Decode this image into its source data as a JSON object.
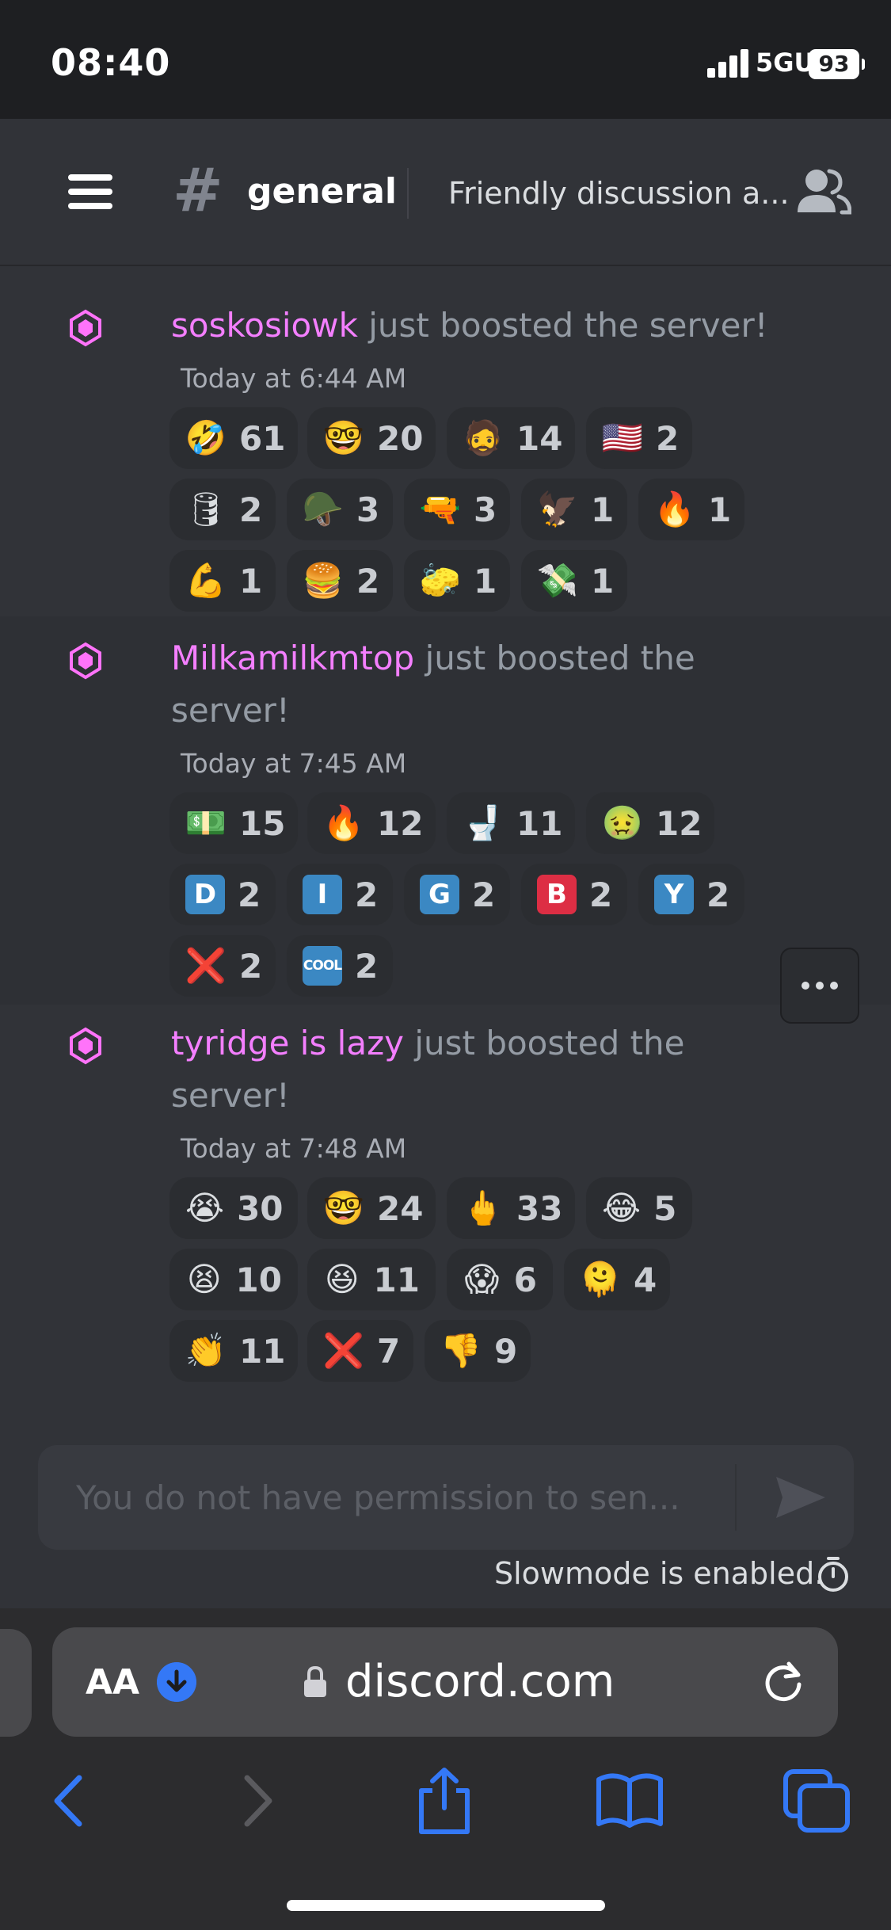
{
  "status_bar": {
    "time": "08:40",
    "network": "5GUC",
    "battery": "93"
  },
  "channel_header": {
    "channel_name": "general",
    "topic": "Friendly discussion a..."
  },
  "messages": [
    {
      "username": "soskosiowk",
      "text": " just boosted the server!",
      "timestamp": "Today at 6:44 AM",
      "reactions": [
        {
          "emoji": "🤣",
          "count": "61"
        },
        {
          "emoji": "🤓",
          "count": "20"
        },
        {
          "emoji": "🧔",
          "count": "14"
        },
        {
          "emoji": "🇺🇸",
          "count": "2"
        },
        {
          "emoji": "🛢",
          "count": "2"
        },
        {
          "emoji": "🪖",
          "count": "3"
        },
        {
          "emoji": "🔫",
          "count": "3"
        },
        {
          "emoji": "🦅",
          "count": "1"
        },
        {
          "emoji": "🔥",
          "count": "1"
        },
        {
          "emoji": "💪",
          "count": "1"
        },
        {
          "emoji": "🍔",
          "count": "2"
        },
        {
          "emoji": "🧽",
          "count": "1"
        },
        {
          "emoji": "💸",
          "count": "1"
        }
      ]
    },
    {
      "username": "Milkamilkmtop",
      "text": " just boosted the server!",
      "timestamp": "Today at 7:45 AM",
      "reactions": [
        {
          "emoji": "💵",
          "count": "15"
        },
        {
          "emoji": "🔥",
          "count": "12"
        },
        {
          "emoji": "🚽",
          "count": "11"
        },
        {
          "emoji": "🤢",
          "count": "12"
        },
        {
          "emoji": "D",
          "count": "2"
        },
        {
          "emoji": "I",
          "count": "2"
        },
        {
          "emoji": "G",
          "count": "2"
        },
        {
          "emoji": "B",
          "count": "2"
        },
        {
          "emoji": "Y",
          "count": "2"
        },
        {
          "emoji": "❌",
          "count": "2"
        },
        {
          "emoji": "COOL",
          "count": "2"
        }
      ]
    },
    {
      "username": "tyridge is lazy",
      "text": " just boosted the server!",
      "timestamp": "Today at 7:48 AM",
      "reactions": [
        {
          "emoji": "😭",
          "count": "30"
        },
        {
          "emoji": "🤓",
          "count": "24"
        },
        {
          "emoji": "🖕",
          "count": "33"
        },
        {
          "emoji": "😂",
          "count": "5"
        },
        {
          "emoji": "😫",
          "count": "10"
        },
        {
          "emoji": "😆",
          "count": "11"
        },
        {
          "emoji": "😱",
          "count": "6"
        },
        {
          "emoji": "🫠",
          "count": "4"
        },
        {
          "emoji": "👏",
          "count": "11"
        },
        {
          "emoji": "❌",
          "count": "7"
        },
        {
          "emoji": "👎",
          "count": "9"
        }
      ]
    }
  ],
  "composer": {
    "placeholder": "You do not have permission to sen..."
  },
  "slowmode_text": "Slowmode is enabled.",
  "browser": {
    "text_size_label": "AA",
    "url": "discord.com"
  },
  "colors": {
    "background": "#313338",
    "username": "#f47fff",
    "browser_accent": "#3478f6"
  }
}
